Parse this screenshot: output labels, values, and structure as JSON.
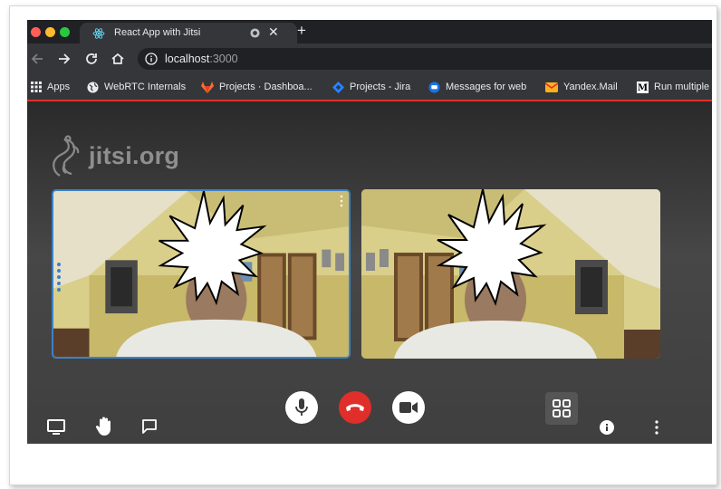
{
  "browser": {
    "tab": {
      "title": "React App with Jitsi"
    },
    "url": {
      "host": "localhost",
      "port": ":3000"
    }
  },
  "bookmarks": [
    {
      "label": "Apps",
      "icon": "apps-grid-icon"
    },
    {
      "label": "WebRTC Internals",
      "icon": "globe-icon"
    },
    {
      "label": "Projects · Dashboa...",
      "icon": "gitlab-icon"
    },
    {
      "label": "Projects - Jira",
      "icon": "jira-icon"
    },
    {
      "label": "Messages for web",
      "icon": "messages-icon"
    },
    {
      "label": "Yandex.Mail",
      "icon": "mail-icon"
    },
    {
      "label": "Run multiple",
      "icon": "medium-icon"
    }
  ],
  "meeting": {
    "watermark": "jitsi.org",
    "participants": [
      {
        "tile": "local",
        "active_speaker": true
      },
      {
        "tile": "remote",
        "active_speaker": false
      }
    ]
  },
  "toolbar": {
    "left": [
      "screen-share-icon",
      "raise-hand-icon",
      "chat-icon"
    ],
    "center": [
      "microphone-icon",
      "hangup-icon",
      "camera-icon"
    ],
    "right": [
      "tile-view-icon",
      "info-icon",
      "more-options-icon"
    ]
  },
  "colors": {
    "accent_border": "#3b82c8",
    "hangup": "#e02e2a",
    "bookmark_underline": "#e0312b"
  }
}
